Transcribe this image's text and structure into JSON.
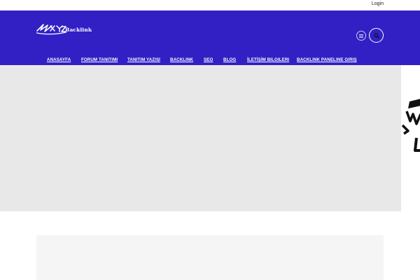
{
  "topbar": {
    "login_label": "Login"
  },
  "logo": {
    "text": "Backlink",
    "icon": "xyz-logo-icon"
  },
  "header": {
    "bg_color": "#3220c5",
    "menu_icon": "hamburger-icon",
    "search_icon": "search-icon"
  },
  "nav": {
    "items": [
      {
        "label": "ANASAYFA"
      },
      {
        "label": "FORUM TANITIMI"
      },
      {
        "label": "TANITIM YAZISI"
      },
      {
        "label": "BACKLINK"
      },
      {
        "label": "SEO"
      },
      {
        "label": "BLOG"
      },
      {
        "label": "İLETİŞİM BILGILERI"
      },
      {
        "label": "BACKLINK PANELINE GIRIŞ"
      }
    ]
  }
}
